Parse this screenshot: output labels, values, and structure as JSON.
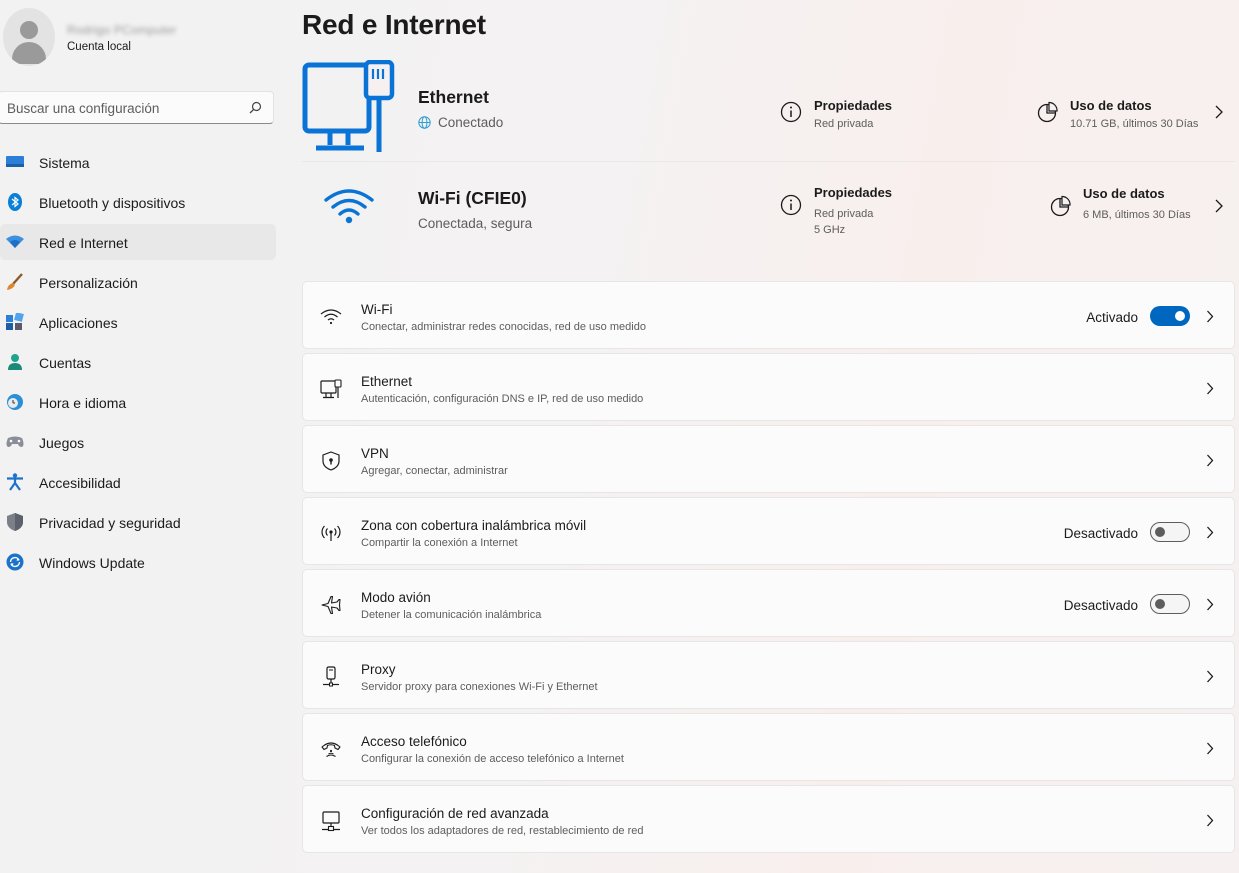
{
  "sidebar": {
    "profile": {
      "name": "Rodrigo PComputer",
      "account_type": "Cuenta local"
    },
    "search": {
      "placeholder": "Buscar una configuración"
    },
    "items": [
      {
        "label": "Sistema",
        "icon": "system-icon"
      },
      {
        "label": "Bluetooth y dispositivos",
        "icon": "bluetooth-icon"
      },
      {
        "label": "Red e Internet",
        "icon": "network-icon",
        "active": true
      },
      {
        "label": "Personalización",
        "icon": "brush-icon"
      },
      {
        "label": "Aplicaciones",
        "icon": "apps-icon"
      },
      {
        "label": "Cuentas",
        "icon": "account-icon"
      },
      {
        "label": "Hora e idioma",
        "icon": "time-language-icon"
      },
      {
        "label": "Juegos",
        "icon": "gamepad-icon"
      },
      {
        "label": "Accesibilidad",
        "icon": "accessibility-icon"
      },
      {
        "label": "Privacidad y seguridad",
        "icon": "shield-icon"
      },
      {
        "label": "Windows Update",
        "icon": "update-icon"
      }
    ]
  },
  "main": {
    "title": "Red e Internet",
    "connections": {
      "ethernet": {
        "name": "Ethernet",
        "status": "Conectado",
        "properties_title": "Propiedades",
        "properties_line1": "Red privada",
        "usage_title": "Uso de datos",
        "usage_value": "10.71 GB, últimos 30 Días"
      },
      "wifi": {
        "name": "Wi-Fi (CFIE0)",
        "status": "Conectada, segura",
        "properties_title": "Propiedades",
        "properties_line1": "Red privada",
        "properties_line2": "5 GHz",
        "usage_title": "Uso de datos",
        "usage_value": "6 MB, últimos 30 Días"
      }
    },
    "settings": {
      "wifi": {
        "title": "Wi-Fi",
        "subtitle": "Conectar, administrar redes conocidas, red de uso medido",
        "state": "Activado",
        "enabled": true
      },
      "ethernet": {
        "title": "Ethernet",
        "subtitle": "Autenticación, configuración DNS e IP, red de uso medido"
      },
      "vpn": {
        "title": "VPN",
        "subtitle": "Agregar, conectar, administrar"
      },
      "hotspot": {
        "title": "Zona con cobertura inalámbrica móvil",
        "subtitle": "Compartir la conexión a Internet",
        "state": "Desactivado",
        "enabled": false
      },
      "airplane": {
        "title": "Modo avión",
        "subtitle": "Detener la comunicación inalámbrica",
        "state": "Desactivado",
        "enabled": false
      },
      "proxy": {
        "title": "Proxy",
        "subtitle": "Servidor proxy para conexiones Wi-Fi y Ethernet"
      },
      "dialup": {
        "title": "Acceso telefónico",
        "subtitle": "Configurar la conexión de acceso telefónico a Internet"
      },
      "advanced": {
        "title": "Configuración de red avanzada",
        "subtitle": "Ver todos los adaptadores de red, restablecimiento de red"
      }
    }
  },
  "colors": {
    "accent": "#0067c0",
    "secondary_text": "#5d5d5d",
    "card_bg": "#fbfbfb"
  }
}
